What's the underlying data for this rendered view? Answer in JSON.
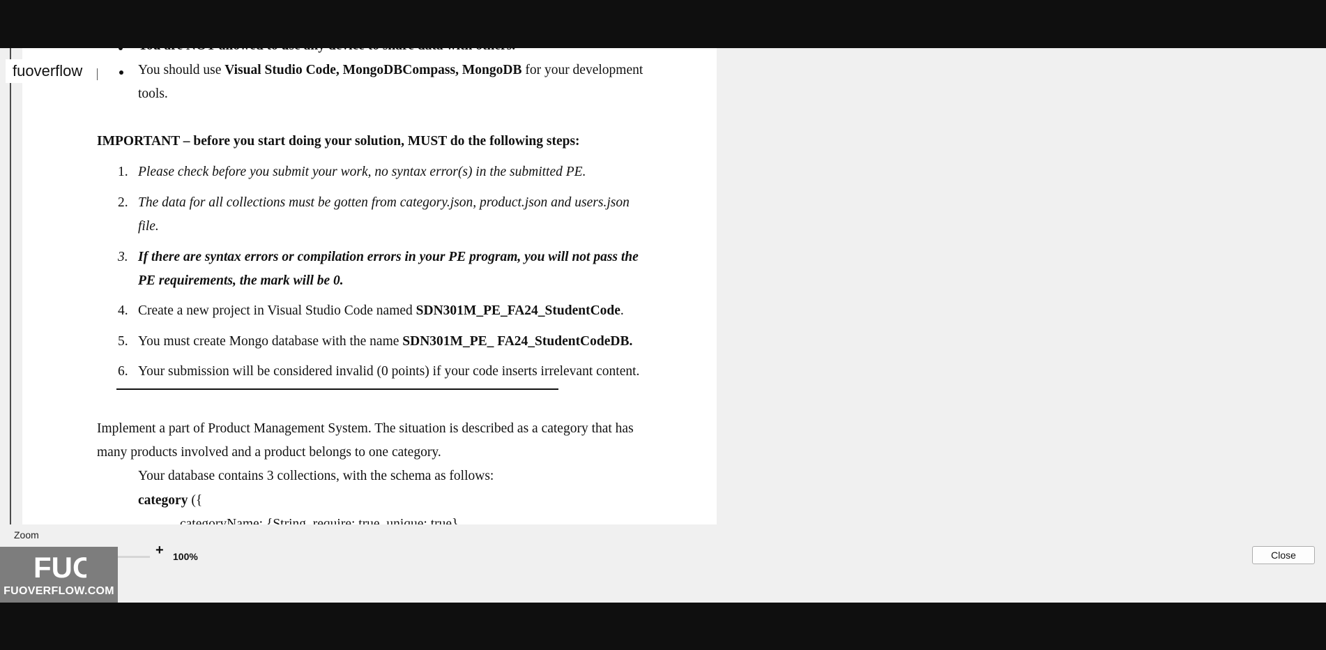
{
  "brand": {
    "label": "fuoverflow",
    "logo_text": "FUOVERFLOW.COM",
    "logo_mark": "FUO"
  },
  "document": {
    "cut_top_line": "You are NOT allowed to use any device to share data with others.",
    "bullet_line1_prefix": "You should use ",
    "bullet_line1_bold": "Visual Studio Code, MongoDBCompass, MongoDB",
    "bullet_line1_suffix": " for your development",
    "bullet_line2": "tools.",
    "important_heading": "IMPORTANT – before you start doing your solution, MUST do the following steps:",
    "steps": {
      "n1": "1.",
      "s1": "Please check before you submit your work, no syntax error(s) in the submitted PE.",
      "n2": "2.",
      "s2a": "The data for all collections must be gotten from category.json, product.json and users.json",
      "s2b": "file.",
      "n3": "3.",
      "s3a": "If there are syntax errors or compilation errors in your PE program, you will not pass the",
      "s3b": "PE requirements, the mark will be 0.",
      "n4": "4.",
      "s4_prefix": "Create a new project in Visual Studio Code named ",
      "s4_bold": "SDN301M_PE_FA24_StudentCode",
      "s4_suffix": ".",
      "n5": "5.",
      "s5_prefix": "You must create Mongo database with the name ",
      "s5_bold": "SDN301M_PE_ FA24_StudentCodeDB.",
      "n6": "6.",
      "s6": "Your submission will be considered invalid (0 points) if your code inserts irrelevant content."
    },
    "para1a": "Implement a part of Product Management System. The situation is described as a category that has",
    "para1b": "many products involved and a product belongs to one category.",
    "para2": "Your database contains 3 collections, with the schema as follows:",
    "category_bold": "category",
    "category_rest": " ({",
    "cut_bottom_line": "categoryName: {String, require: true, unique: true}"
  },
  "controls": {
    "zoom_label": "Zoom",
    "minus": "-",
    "plus": "+",
    "zoom_value": "100%",
    "zoom_level_percent": 100,
    "close_label": "Close"
  }
}
